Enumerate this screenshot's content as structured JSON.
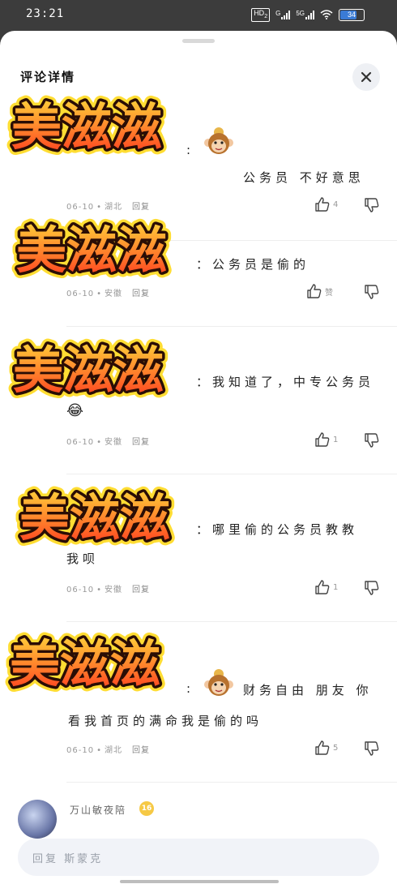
{
  "status_bar": {
    "time": "23:21",
    "network1": "HD",
    "network1_sub": "2",
    "network1_gen": "G",
    "network2": "5G",
    "battery": "34"
  },
  "sheet": {
    "title": "评论详情",
    "close_icon": "close-icon"
  },
  "sticker_text": "美滋滋",
  "comments": [
    {
      "text": "公务员 不好意思",
      "date": "06-10",
      "location": "湖北",
      "reply": "回复",
      "likes": "4"
    },
    {
      "text": "：公务员是偷的",
      "date": "06-10",
      "location": "安徽",
      "reply": "回复",
      "likes": "赞"
    },
    {
      "text": "：我知道了，中专公务员",
      "emoji": "😂",
      "date": "06-10",
      "location": "安徽",
      "reply": "回复",
      "likes": "1"
    },
    {
      "text": "：哪里偷的公务员教教",
      "text2": "我呗",
      "date": "06-10",
      "location": "安徽",
      "reply": "回复",
      "likes": "1"
    },
    {
      "text": "财务自由 朋友 你",
      "text2": "看我首页的满命我是偷的吗",
      "date": "06-10",
      "location": "湖北",
      "reply": "回复",
      "likes": "5"
    }
  ],
  "next_comment": {
    "username": "万山敏夜陪",
    "level": "16"
  },
  "reply_input": {
    "placeholder": "回复 斯蒙克"
  },
  "colors": {
    "sticker_fill_top": "#ffd23a",
    "sticker_fill_bottom": "#ff3b1f",
    "sticker_stroke": "#2a0d05",
    "sticker_glow": "#ffdd33"
  }
}
